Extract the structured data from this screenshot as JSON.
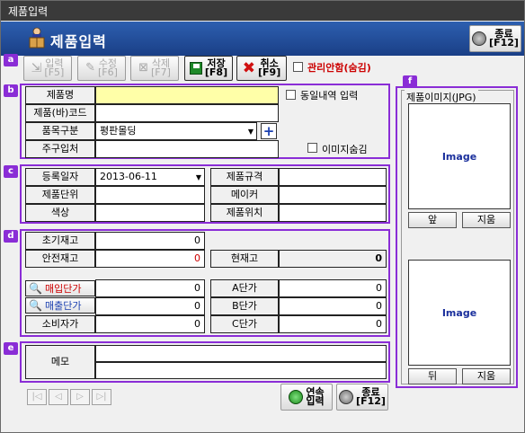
{
  "window": {
    "title": "제품입력"
  },
  "header": {
    "title": "제품입력",
    "close_button": {
      "label_top": "종료",
      "label_bottom": "[F12]"
    }
  },
  "toolbar": {
    "input": {
      "top": "입력",
      "bottom": "[F5]"
    },
    "edit": {
      "top": "수정",
      "bottom": "[F6]"
    },
    "delete": {
      "top": "삭제",
      "bottom": "[F7]"
    },
    "save": {
      "top": "저장",
      "bottom": "[F8]"
    },
    "cancel": {
      "top": "취소",
      "bottom": "[F9]"
    },
    "admin_hide_label": "관리안함(숨김)"
  },
  "badges": {
    "a": "a",
    "b": "b",
    "c": "c",
    "d": "d",
    "e": "e",
    "f": "f"
  },
  "section_b": {
    "product_name_label": "제품명",
    "product_name_value": "",
    "same_history_label": "동일내역 입력",
    "barcode_label": "제품(바)코드",
    "barcode_value": "",
    "category_label": "품목구분",
    "category_value": "평판몰딩",
    "main_supplier_label": "주구입처",
    "main_supplier_value": "",
    "hide_image_label": "이미지숨김"
  },
  "section_c": {
    "reg_date_label": "등록일자",
    "reg_date_value": "2013-06-11",
    "spec_label": "제품규격",
    "unit_label": "제품단위",
    "maker_label": "메이커",
    "color_label": "색상",
    "location_label": "제품위치"
  },
  "section_d": {
    "initial_stock_label": "초기재고",
    "initial_stock_value": "0",
    "safety_stock_label": "안전재고",
    "safety_stock_value": "0",
    "current_stock_label": "현재고",
    "current_stock_value": "0",
    "buy_price_label": "매입단가",
    "buy_price_value": "0",
    "sell_price_label": "매출단가",
    "sell_price_value": "0",
    "consumer_price_label": "소비자가",
    "consumer_price_value": "0",
    "a_price_label": "A단가",
    "a_price_value": "0",
    "b_price_label": "B단가",
    "b_price_value": "0",
    "c_price_label": "C단가",
    "c_price_value": "0"
  },
  "section_e": {
    "memo_label": "메모",
    "memo_line1": "",
    "memo_line2": ""
  },
  "section_f": {
    "title": "제품이미지(JPG)",
    "image1_placeholder": "Image",
    "front_button": "앞",
    "delete1_button": "지움",
    "image2_placeholder": "Image",
    "back_button": "뒤",
    "delete2_button": "지움"
  },
  "footer": {
    "continuous_input": {
      "top": "연속",
      "bottom": "입력"
    },
    "close": {
      "top": "종료",
      "bottom": "[F12]"
    },
    "nav": [
      "|◁",
      "◁",
      "▷",
      "▷|"
    ]
  },
  "colors": {
    "accent_purple": "#8a2dd6",
    "header_blue": "#1a3f86",
    "required_yellow": "#ffffa8",
    "alert_red": "#cc0000"
  }
}
